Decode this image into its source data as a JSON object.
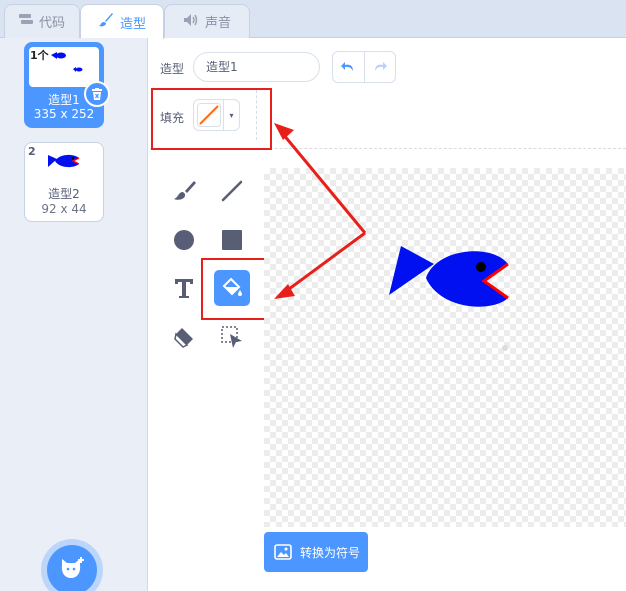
{
  "tabs": [
    {
      "label": "代码",
      "icon": "code-blocks-icon"
    },
    {
      "label": "造型",
      "icon": "brush-icon"
    },
    {
      "label": "声音",
      "icon": "speaker-icon"
    }
  ],
  "costumes": [
    {
      "number": "1",
      "thumb_text": "1个",
      "name": "造型1",
      "size": "335 x 252",
      "selected": true
    },
    {
      "number": "2",
      "name": "造型2",
      "size": "92 x 44",
      "selected": false
    }
  ],
  "editor": {
    "costume_label": "造型",
    "costume_name": "造型1",
    "fill_label": "填充",
    "fill_color": "#ff6b1a"
  },
  "tools": [
    "brush-icon",
    "line-icon",
    "circle-icon",
    "rectangle-icon",
    "text-icon",
    "fill-icon",
    "eraser-icon",
    "select-icon"
  ],
  "convert_label": "转换为符号",
  "colors": {
    "accent": "#4c97ff",
    "fish": "#0010f0",
    "mouth": "#ff0000",
    "annotation": "#e8201b"
  }
}
